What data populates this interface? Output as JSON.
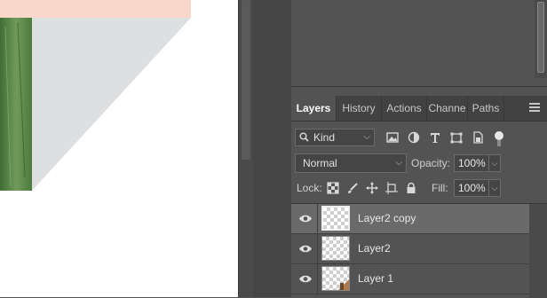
{
  "colors": {
    "panel_bg": "#535353",
    "tab_bar_bg": "#424242",
    "selected_row_bg": "#6a6a6a",
    "canvas_bg": "#ffffff",
    "photo_peach": "#f9d7cb",
    "photo_gray": "#dedfe0",
    "photo_green": "#5c8a4a"
  },
  "layers_panel": {
    "tabs": [
      {
        "label": "Layers",
        "active": true
      },
      {
        "label": "History",
        "active": false
      },
      {
        "label": "Actions",
        "active": false
      },
      {
        "label": "Channe",
        "active": false
      },
      {
        "label": "Paths",
        "active": false
      }
    ],
    "menu_icon": "hamburger-menu-icon",
    "filter": {
      "kind_label": "Kind",
      "icons": [
        "image-filter-icon",
        "adjustment-filter-icon",
        "type-filter-icon",
        "shape-filter-icon",
        "smart-object-filter-icon",
        "filter-toggle-icon"
      ]
    },
    "blend_mode": "Normal",
    "opacity_label": "Opacity:",
    "opacity_value": "100%",
    "lock_label": "Lock:",
    "lock_icons": [
      "lock-transparent-pixels-icon",
      "lock-image-pixels-icon",
      "lock-position-icon",
      "lock-artboard-icon",
      "lock-all-icon"
    ],
    "fill_label": "Fill:",
    "fill_value": "100%",
    "layers": [
      {
        "name": "Layer2 copy",
        "selected": true,
        "visible": true
      },
      {
        "name": "Layer2",
        "selected": false,
        "visible": true
      },
      {
        "name": "Layer 1",
        "selected": false,
        "visible": true
      }
    ]
  }
}
